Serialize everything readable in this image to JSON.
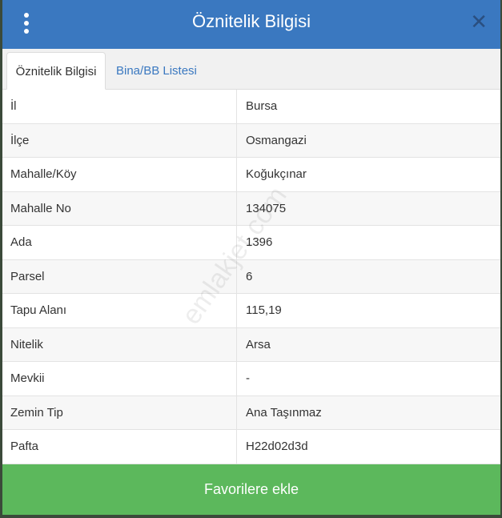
{
  "header": {
    "title": "Öznitelik Bilgisi",
    "close_glyph": "✕"
  },
  "tabs": [
    {
      "label": "Öznitelik Bilgisi",
      "active": true
    },
    {
      "label": "Bina/BB Listesi",
      "active": false
    }
  ],
  "rows": [
    {
      "key": "İl",
      "value": "Bursa"
    },
    {
      "key": "İlçe",
      "value": "Osmangazi"
    },
    {
      "key": "Mahalle/Köy",
      "value": "Koğukçınar"
    },
    {
      "key": "Mahalle No",
      "value": "134075"
    },
    {
      "key": "Ada",
      "value": "1396"
    },
    {
      "key": "Parsel",
      "value": "6"
    },
    {
      "key": "Tapu Alanı",
      "value": "115,19"
    },
    {
      "key": "Nitelik",
      "value": "Arsa"
    },
    {
      "key": "Mevkii",
      "value": "-"
    },
    {
      "key": "Zemin Tip",
      "value": "Ana Taşınmaz"
    },
    {
      "key": "Pafta",
      "value": "H22d02d3d"
    }
  ],
  "watermark": "emlakjet.com",
  "favorite_button": "Favorilere ekle",
  "colors": {
    "header": "#3a78c0",
    "button": "#5cb85c"
  }
}
